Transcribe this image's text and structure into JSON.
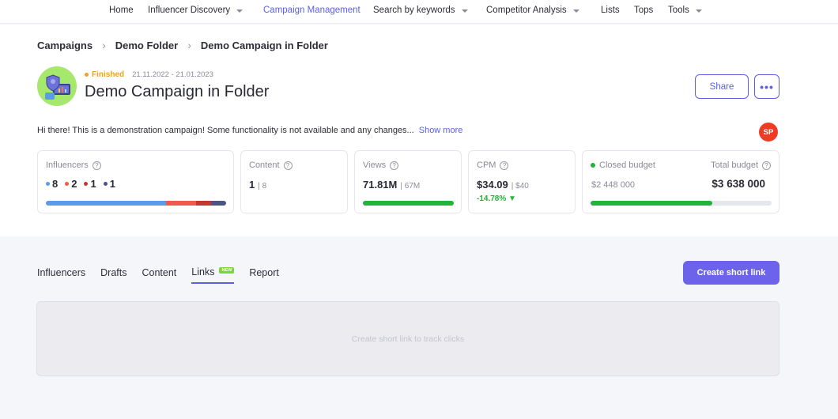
{
  "nav": {
    "home": "Home",
    "influencer_discovery": "Influencer Discovery",
    "campaign_management": "Campaign Management",
    "search_by_keywords": "Search by keywords",
    "competitor_analysis": "Competitor Analysis",
    "lists": "Lists",
    "tops": "Tops",
    "tools": "Tools"
  },
  "breadcrumb": {
    "campaigns": "Campaigns",
    "folder": "Demo Folder",
    "current": "Demo Campaign in Folder"
  },
  "campaign": {
    "status": "Finished",
    "dates": "21.11.2022 - 21.01.2023",
    "title": "Demo Campaign in Folder",
    "description": "Hi there! This is a demonstration campaign! Some functionality is not available and any changes...",
    "show_more": "Show more",
    "share_label": "Share",
    "more_label": "•••",
    "user_initials": "SP"
  },
  "stats": {
    "influencers": {
      "label": "Influencers",
      "counts": [
        {
          "value": "8",
          "color": "#5b9be8"
        },
        {
          "value": "2",
          "color": "#f05a4a"
        },
        {
          "value": "1",
          "color": "#c0392b"
        },
        {
          "value": "1",
          "color": "#4a5488"
        }
      ]
    },
    "content": {
      "label": "Content",
      "value": "1",
      "sub": "| 8"
    },
    "views": {
      "label": "Views",
      "value": "71.81M",
      "sub": "| 67M",
      "progress": 1.0
    },
    "cpm": {
      "label": "CPM",
      "value": "$34.09",
      "sub": "| $40",
      "delta": "-14.78% ▼"
    },
    "budget": {
      "closed_label": "Closed budget",
      "closed_value": "$2 448 000",
      "total_label": "Total budget",
      "total_value": "$3 638 000",
      "progress": 0.673
    }
  },
  "tabs": {
    "influencers": "Influencers",
    "drafts": "Drafts",
    "content": "Content",
    "links": "Links",
    "links_badge": "NEW",
    "report": "Report",
    "active": "Links"
  },
  "actions": {
    "create_short_link": "Create short link"
  },
  "empty_state": {
    "message": "Create short link to track clicks"
  },
  "colors": {
    "accent": "#5b5fe0",
    "primary_button": "#6d63ea",
    "status_finished": "#f0a21e",
    "success": "#21b43a",
    "avatar_bg": "#a6e86b",
    "badge_user": "#ef3b24"
  }
}
